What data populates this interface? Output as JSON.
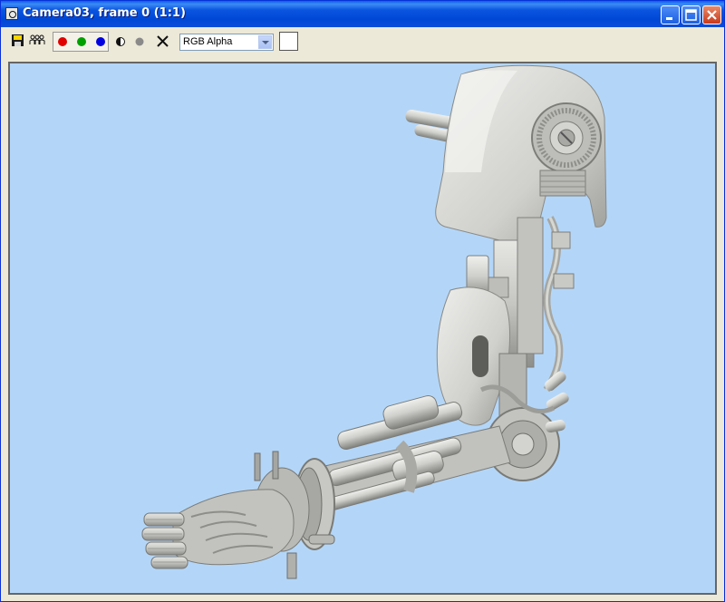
{
  "window": {
    "title": "Camera03, frame 0 (1:1)",
    "title_color": "#0a55e0"
  },
  "toolbar": {
    "channel_select": {
      "selected": "RGB Alpha"
    },
    "tools": [
      {
        "name": "save-image",
        "icon": "floppy-disk-icon"
      },
      {
        "name": "clone-window",
        "icon": "clone-icon"
      },
      {
        "name": "red-channel",
        "icon": "red-dot-icon",
        "color": "#e00000"
      },
      {
        "name": "green-channel",
        "icon": "green-dot-icon",
        "color": "#00a000"
      },
      {
        "name": "blue-channel",
        "icon": "blue-dot-icon",
        "color": "#0000e0"
      },
      {
        "name": "monochrome",
        "icon": "half-circle-icon"
      },
      {
        "name": "alpha-channel",
        "icon": "gray-dot-icon"
      },
      {
        "name": "clear",
        "icon": "x-icon"
      }
    ],
    "swatch_color": "#ffffff"
  },
  "viewport": {
    "background_color": "#b3d6f8",
    "content": "rendered-robot-arm"
  }
}
